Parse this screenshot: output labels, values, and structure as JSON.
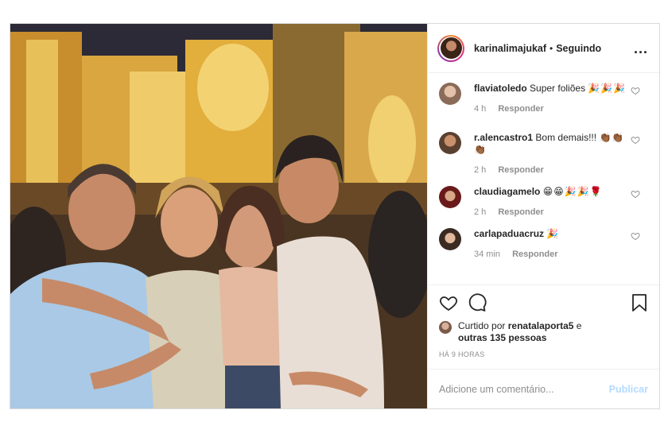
{
  "header": {
    "username": "karinalimajukaf",
    "separator": "•",
    "follow_status": "Seguindo",
    "more_label": "..."
  },
  "comments": [
    {
      "user": "flaviatoledo",
      "text": "Super foliões",
      "emoji": "🎉🎉🎉",
      "time": "4 h",
      "reply": "Responder"
    },
    {
      "user": "r.alencastro1",
      "text": "Bom demais!!!",
      "emoji": "👏🏾👏🏾👏🏾",
      "time": "2 h",
      "reply": "Responder"
    },
    {
      "user": "claudiagamelo",
      "text": "",
      "emoji": "😁😁🎉🎉🌹",
      "time": "2 h",
      "reply": "Responder"
    },
    {
      "user": "carlapaduacruz",
      "text": "",
      "emoji": "🎉",
      "time": "34 min",
      "reply": "Responder"
    }
  ],
  "likes": {
    "prefix": "Curtido por",
    "user": "renatalaporta5",
    "conj": "e",
    "others": "outras 135 pessoas"
  },
  "timestamp": "HÁ 9 HORAS",
  "add_comment": {
    "placeholder": "Adicione um comentário...",
    "post_label": "Publicar"
  },
  "colors": {
    "link_disabled": "#b3dbff",
    "muted": "#8e8e8e",
    "text": "#262626"
  }
}
